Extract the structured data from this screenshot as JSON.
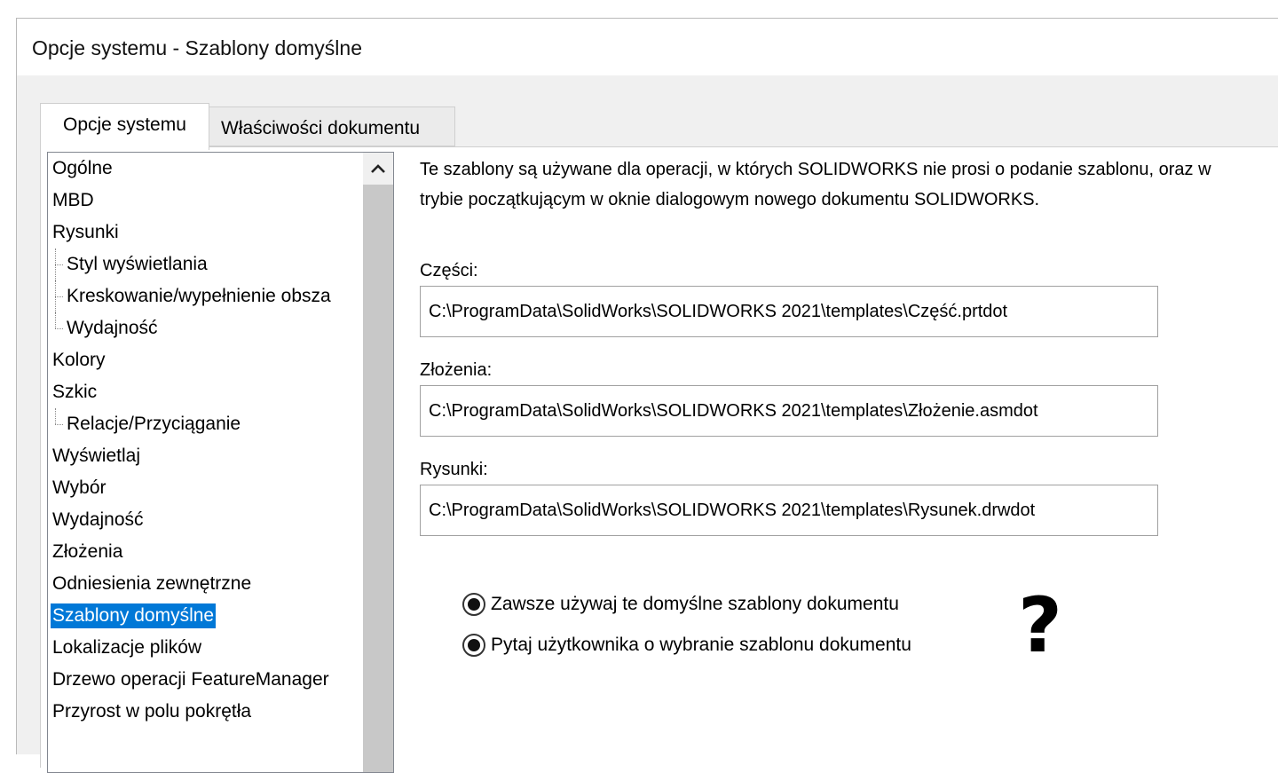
{
  "window": {
    "title": "Opcje systemu - Szablony domyślne"
  },
  "tabs": [
    {
      "label": "Opcje systemu",
      "active": true
    },
    {
      "label": "Właściwości dokumentu",
      "active": false
    }
  ],
  "tree": {
    "items": [
      {
        "label": "Ogólne",
        "child": false
      },
      {
        "label": "MBD",
        "child": false
      },
      {
        "label": "Rysunki",
        "child": false
      },
      {
        "label": "Styl wyświetlania",
        "child": true
      },
      {
        "label": "Kreskowanie/wypełnienie obsza",
        "child": true
      },
      {
        "label": "Wydajność",
        "child": true
      },
      {
        "label": "Kolory",
        "child": false
      },
      {
        "label": "Szkic",
        "child": false
      },
      {
        "label": "Relacje/Przyciąganie",
        "child": true
      },
      {
        "label": "Wyświetlaj",
        "child": false
      },
      {
        "label": "Wybór",
        "child": false
      },
      {
        "label": "Wydajność",
        "child": false
      },
      {
        "label": "Złożenia",
        "child": false
      },
      {
        "label": "Odniesienia zewnętrzne",
        "child": false
      },
      {
        "label": "Szablony domyślne",
        "child": false,
        "selected": true
      },
      {
        "label": "Lokalizacje plików",
        "child": false
      },
      {
        "label": "Drzewo operacji FeatureManager",
        "child": false
      },
      {
        "label": "Przyrost w polu pokrętła",
        "child": false
      }
    ],
    "scroll_up_icon": "chevron-up-icon"
  },
  "main": {
    "description": "Te szablony są używane dla operacji, w których SOLIDWORKS nie prosi o podanie szablonu, oraz w trybie początkującym w oknie dialogowym nowego dokumentu SOLIDWORKS.",
    "fields": [
      {
        "label": "Części:",
        "value": "C:\\ProgramData\\SolidWorks\\SOLIDWORKS 2021\\templates\\Część.prtdot"
      },
      {
        "label": "Złożenia:",
        "value": "C:\\ProgramData\\SolidWorks\\SOLIDWORKS 2021\\templates\\Złożenie.asmdot"
      },
      {
        "label": "Rysunki:",
        "value": "C:\\ProgramData\\SolidWorks\\SOLIDWORKS 2021\\templates\\Rysunek.drwdot"
      }
    ],
    "radios": [
      {
        "label": "Zawsze używaj te domyślne szablony dokumentu",
        "checked": true
      },
      {
        "label": "Pytaj użytkownika o wybranie szablonu dokumentu",
        "checked": true
      }
    ],
    "question_mark": "?"
  }
}
